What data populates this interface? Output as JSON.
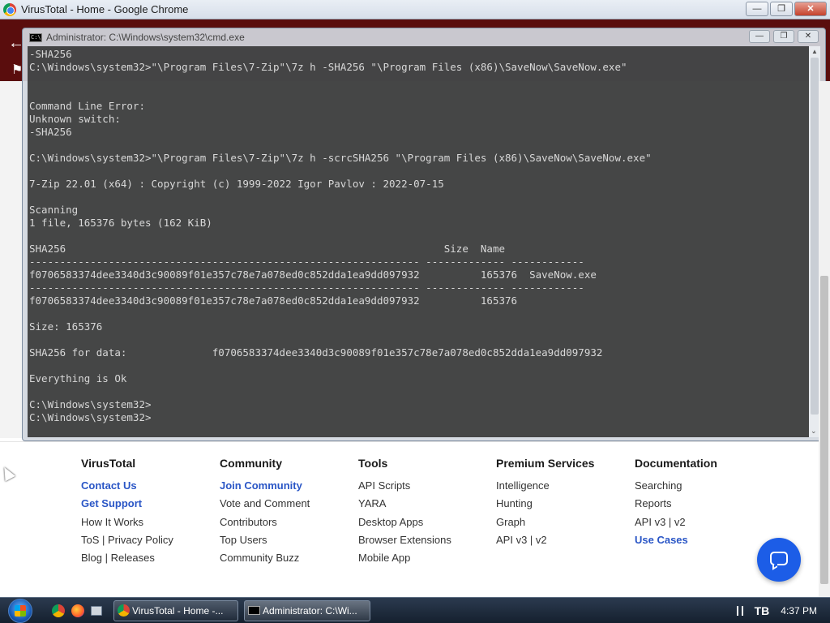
{
  "chrome": {
    "window_title": "VirusTotal - Home - Google Chrome",
    "btn_min": "—",
    "btn_max": "❐",
    "btn_close": "✕"
  },
  "cmd": {
    "window_title": "Administrator: C:\\Windows\\system32\\cmd.exe",
    "icon_text": "C:\\",
    "lines": [
      "-SHA256",
      "C:\\Windows\\system32>\"\\Program Files\\7-Zip\"\\7z h -SHA256 \"\\Program Files (x86)\\SaveNow\\SaveNow.exe\"",
      "",
      "",
      "Command Line Error:",
      "Unknown switch:",
      "-SHA256",
      "",
      "C:\\Windows\\system32>\"\\Program Files\\7-Zip\"\\7z h -scrcSHA256 \"\\Program Files (x86)\\SaveNow\\SaveNow.exe\"",
      "",
      "7-Zip 22.01 (x64) : Copyright (c) 1999-2022 Igor Pavlov : 2022-07-15",
      "",
      "Scanning",
      "1 file, 165376 bytes (162 KiB)",
      "",
      "SHA256                                                              Size  Name",
      "---------------------------------------------------------------- ------------- ------------",
      "f0706583374dee3340d3c90089f01e357c78e7a078ed0c852dda1ea9dd097932          165376  SaveNow.exe",
      "---------------------------------------------------------------- ------------- ------------",
      "f0706583374dee3340d3c90089f01e357c78e7a078ed0c852dda1ea9dd097932          165376",
      "",
      "Size: 165376",
      "",
      "SHA256 for data:              f0706583374dee3340d3c90089f01e357c78e7a078ed0c852dda1ea9dd097932",
      "",
      "Everything is Ok",
      "",
      "C:\\Windows\\system32>",
      "C:\\Windows\\system32>"
    ]
  },
  "footer": {
    "columns": [
      {
        "heading": "VirusTotal",
        "links": [
          {
            "label": "Contact Us",
            "style": "blue"
          },
          {
            "label": "Get Support",
            "style": "blue"
          },
          {
            "label": "How It Works",
            "style": "plain"
          },
          {
            "label": "ToS | Privacy Policy",
            "style": "plain"
          },
          {
            "label": "Blog | Releases",
            "style": "plain"
          }
        ]
      },
      {
        "heading": "Community",
        "links": [
          {
            "label": "Join Community",
            "style": "blue"
          },
          {
            "label": "Vote and Comment",
            "style": "plain"
          },
          {
            "label": "Contributors",
            "style": "plain"
          },
          {
            "label": "Top Users",
            "style": "plain"
          },
          {
            "label": "Community Buzz",
            "style": "plain"
          }
        ]
      },
      {
        "heading": "Tools",
        "links": [
          {
            "label": "API Scripts",
            "style": "plain"
          },
          {
            "label": "YARA",
            "style": "plain"
          },
          {
            "label": "Desktop Apps",
            "style": "plain"
          },
          {
            "label": "Browser Extensions",
            "style": "plain"
          },
          {
            "label": "Mobile App",
            "style": "plain"
          }
        ]
      },
      {
        "heading": "Premium Services",
        "links": [
          {
            "label": "Intelligence",
            "style": "plain"
          },
          {
            "label": "Hunting",
            "style": "plain"
          },
          {
            "label": "Graph",
            "style": "plain"
          },
          {
            "label": "API v3 | v2",
            "style": "plain"
          }
        ]
      },
      {
        "heading": "Documentation",
        "links": [
          {
            "label": "Searching",
            "style": "plain"
          },
          {
            "label": "Reports",
            "style": "plain"
          },
          {
            "label": "API v3 | v2",
            "style": "plain"
          },
          {
            "label": "Use Cases",
            "style": "blue"
          }
        ]
      }
    ]
  },
  "taskbar": {
    "items": [
      {
        "label": "VirusTotal - Home -...",
        "icon": "chrome-icon"
      },
      {
        "label": "Administrator: C:\\Wi...",
        "icon": "cmd-icon"
      }
    ],
    "clock": "4:37 PM"
  },
  "colors": {
    "link_blue": "#2a56c6",
    "chat_button": "#1c5de7",
    "browser_bar": "#5a0d0d",
    "console_bg": "#3a3a3a"
  }
}
